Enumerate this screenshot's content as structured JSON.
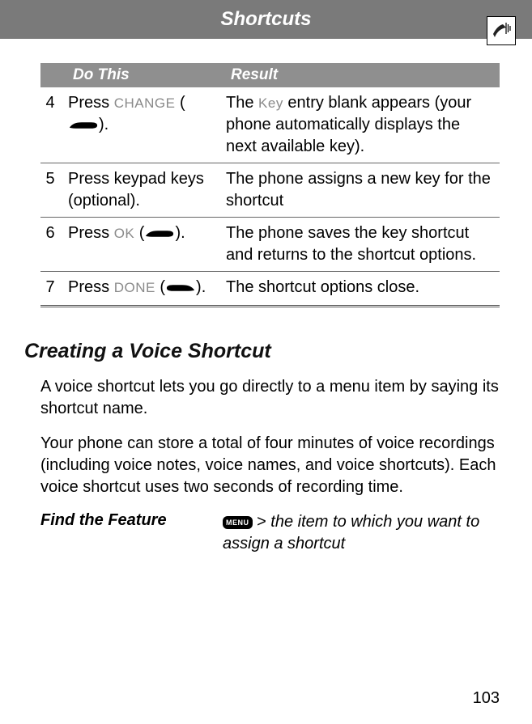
{
  "header": {
    "title": "Shortcuts"
  },
  "table": {
    "headers": {
      "do": "Do This",
      "result": "Result"
    },
    "rows": [
      {
        "num": "4",
        "do_pre": "Press ",
        "do_key": "CHANGE",
        "do_paren_open": " (",
        "do_paren_close": ").",
        "softkey_dir": "right",
        "result_pre": "The ",
        "result_key": "Key",
        "result_post": " entry blank appears (your phone automatically displays the next available key)."
      },
      {
        "num": "5",
        "do_plain": "Press keypad keys (optional).",
        "result_plain": "The phone assigns a new key for the shortcut"
      },
      {
        "num": "6",
        "do_pre": "Press ",
        "do_key": "OK",
        "do_paren_open": " (",
        "do_paren_close": ").",
        "softkey_dir": "right",
        "result_plain": "The phone saves the key shortcut and returns to the shortcut options."
      },
      {
        "num": "7",
        "do_pre": "Press ",
        "do_key": "DONE",
        "do_paren_open": " (",
        "do_paren_close": ").",
        "softkey_dir": "left",
        "result_plain": "The shortcut options close."
      }
    ]
  },
  "section": {
    "heading": "Creating a Voice Shortcut",
    "para1": "A voice shortcut lets you go directly to a menu item by saying its shortcut name.",
    "para2": "Your phone can store a total of four minutes of voice recordings (including voice notes, voice names, and voice shortcuts). Each voice shortcut uses two seconds of recording time."
  },
  "find": {
    "label": "Find the Feature",
    "menu_label": "MENU",
    "gt": ">",
    "rest": " the item to which you want to assign a shortcut"
  },
  "page": "103"
}
